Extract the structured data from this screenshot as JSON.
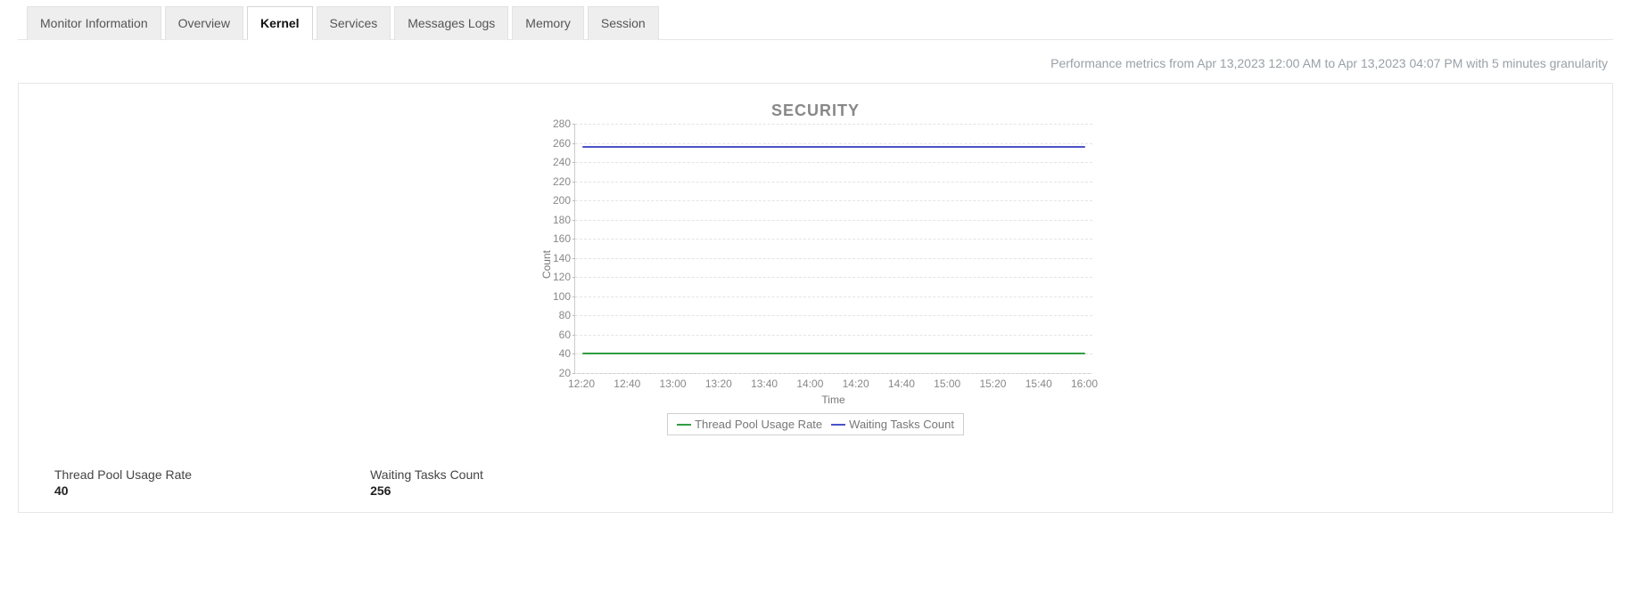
{
  "tabs": [
    {
      "id": "monitor",
      "label": "Monitor Information",
      "active": false
    },
    {
      "id": "overview",
      "label": "Overview",
      "active": false
    },
    {
      "id": "kernel",
      "label": "Kernel",
      "active": true
    },
    {
      "id": "services",
      "label": "Services",
      "active": false
    },
    {
      "id": "messages",
      "label": "Messages Logs",
      "active": false
    },
    {
      "id": "memory",
      "label": "Memory",
      "active": false
    },
    {
      "id": "session",
      "label": "Session",
      "active": false
    }
  ],
  "metrics_caption": "Performance metrics from Apr 13,2023 12:00 AM to Apr 13,2023 04:07 PM with 5 minutes granularity",
  "chart_data": {
    "type": "line",
    "title": "SECURITY",
    "xlabel": "Time",
    "ylabel": "Count",
    "ylim": [
      20,
      280
    ],
    "yticks": [
      280,
      260,
      240,
      220,
      200,
      180,
      160,
      140,
      120,
      100,
      80,
      60,
      40,
      20
    ],
    "x": [
      "12:20",
      "12:40",
      "13:00",
      "13:20",
      "13:40",
      "14:00",
      "14:20",
      "14:40",
      "15:00",
      "15:20",
      "15:40",
      "16:00"
    ],
    "series": [
      {
        "name": "Thread Pool Usage Rate",
        "color": "#2e9e40",
        "values": [
          40,
          40,
          40,
          40,
          40,
          40,
          40,
          40,
          40,
          40,
          40,
          40
        ]
      },
      {
        "name": "Waiting Tasks Count",
        "color": "#4a52c7",
        "values": [
          256,
          256,
          256,
          256,
          256,
          256,
          256,
          256,
          256,
          256,
          256,
          256
        ]
      }
    ],
    "legend_position": "bottom"
  },
  "summary": {
    "thread_pool_label": "Thread Pool Usage Rate",
    "thread_pool_value": "40",
    "waiting_tasks_label": "Waiting Tasks Count",
    "waiting_tasks_value": "256"
  }
}
